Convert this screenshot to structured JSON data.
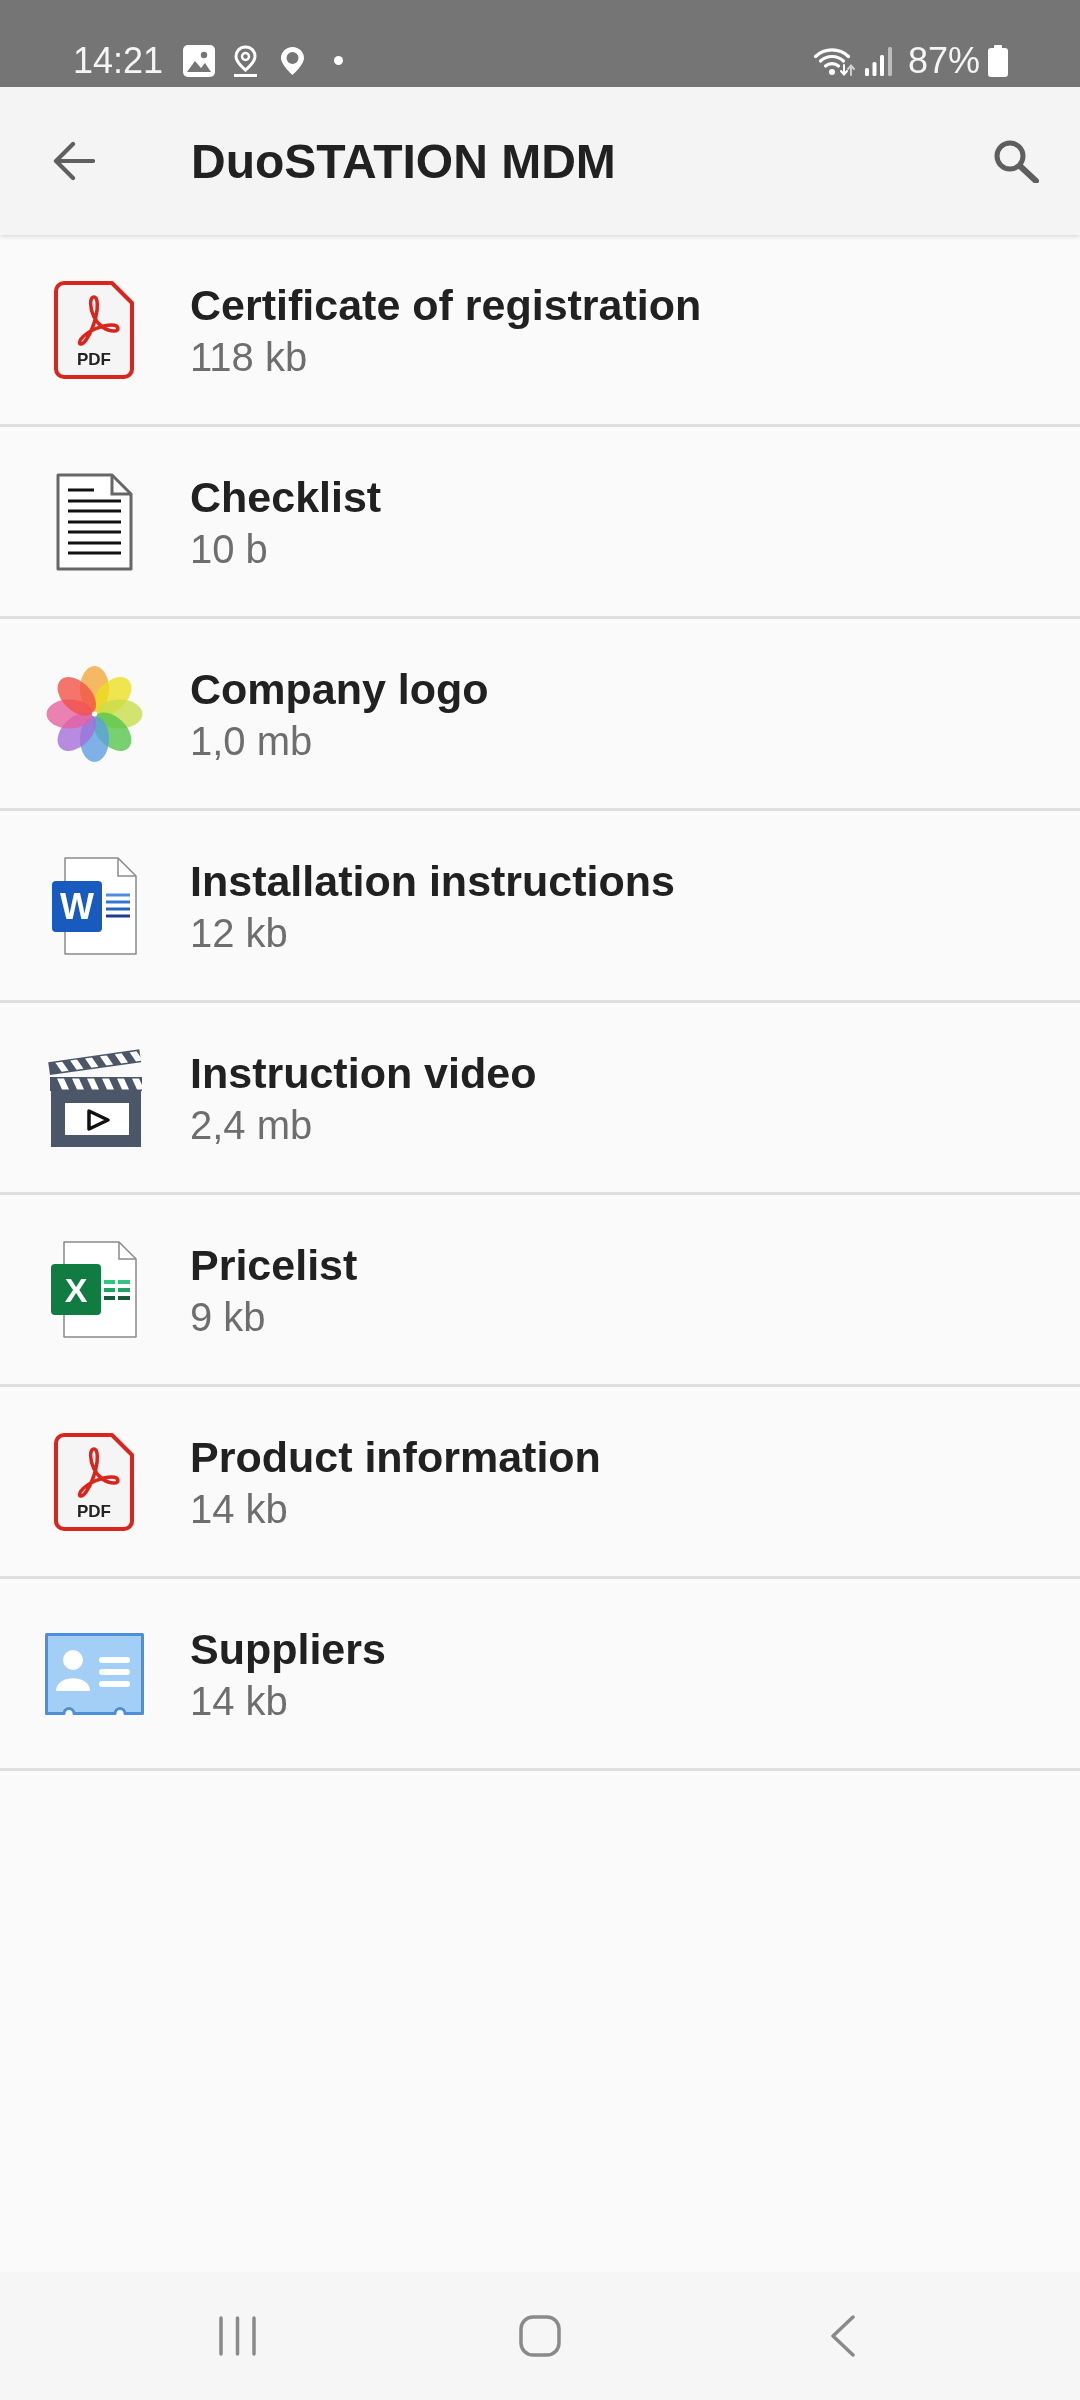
{
  "status_bar": {
    "time": "14:21",
    "battery": "87%"
  },
  "app_bar": {
    "title": "DuoSTATION MDM"
  },
  "files": [
    {
      "kind": "pdf",
      "icon_text": "PDF",
      "name": "Certificate of registration",
      "size": "118 kb"
    },
    {
      "kind": "text",
      "name": "Checklist",
      "size": "10 b"
    },
    {
      "kind": "image",
      "name": "Company logo",
      "size": "1,0 mb"
    },
    {
      "kind": "word",
      "icon_text": "W",
      "name": "Installation instructions",
      "size": "12 kb"
    },
    {
      "kind": "video",
      "name": "Instruction video",
      "size": "2,4 mb"
    },
    {
      "kind": "excel",
      "icon_text": "X",
      "name": "Pricelist",
      "size": "9 kb"
    },
    {
      "kind": "pdf",
      "icon_text": "PDF",
      "name": "Product information",
      "size": "14 kb"
    },
    {
      "kind": "contact",
      "name": "Suppliers",
      "size": "14 kb"
    }
  ]
}
